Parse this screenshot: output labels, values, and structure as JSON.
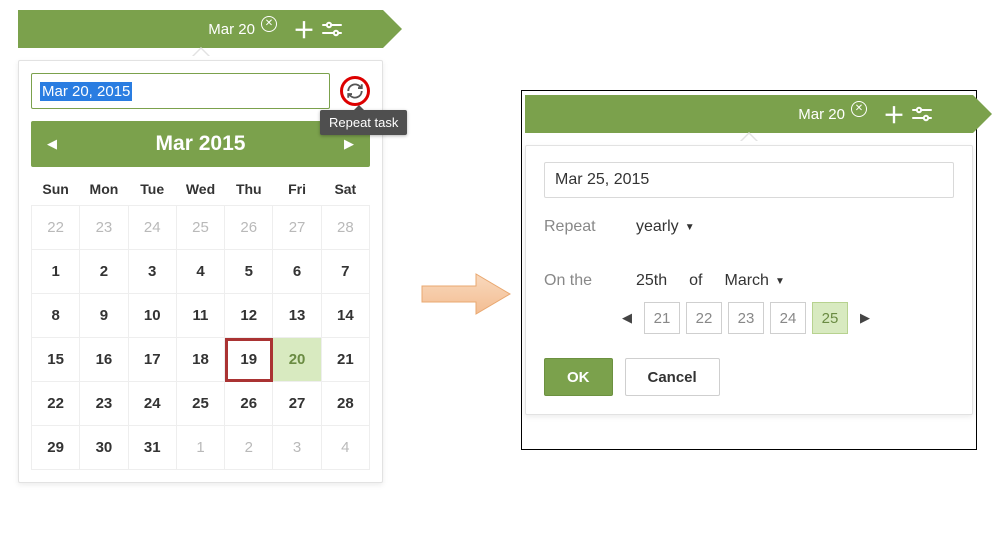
{
  "banner": {
    "date_label": "Mar 20"
  },
  "left": {
    "selected_date_text": "Mar 20, 2015",
    "tooltip": "Repeat task",
    "month_title": "Mar 2015",
    "weekdays": [
      "Sun",
      "Mon",
      "Tue",
      "Wed",
      "Thu",
      "Fri",
      "Sat"
    ],
    "grid": [
      [
        {
          "n": "22",
          "muted": true
        },
        {
          "n": "23",
          "muted": true
        },
        {
          "n": "24",
          "muted": true
        },
        {
          "n": "25",
          "muted": true
        },
        {
          "n": "26",
          "muted": true
        },
        {
          "n": "27",
          "muted": true
        },
        {
          "n": "28",
          "muted": true
        }
      ],
      [
        {
          "n": "1"
        },
        {
          "n": "2"
        },
        {
          "n": "3"
        },
        {
          "n": "4"
        },
        {
          "n": "5"
        },
        {
          "n": "6"
        },
        {
          "n": "7"
        }
      ],
      [
        {
          "n": "8"
        },
        {
          "n": "9"
        },
        {
          "n": "10"
        },
        {
          "n": "11"
        },
        {
          "n": "12"
        },
        {
          "n": "13"
        },
        {
          "n": "14"
        }
      ],
      [
        {
          "n": "15"
        },
        {
          "n": "16"
        },
        {
          "n": "17"
        },
        {
          "n": "18"
        },
        {
          "n": "19",
          "today": true
        },
        {
          "n": "20",
          "sel": true
        },
        {
          "n": "21"
        }
      ],
      [
        {
          "n": "22"
        },
        {
          "n": "23"
        },
        {
          "n": "24"
        },
        {
          "n": "25"
        },
        {
          "n": "26"
        },
        {
          "n": "27"
        },
        {
          "n": "28"
        }
      ],
      [
        {
          "n": "29"
        },
        {
          "n": "30"
        },
        {
          "n": "31"
        },
        {
          "n": "1",
          "muted": true
        },
        {
          "n": "2",
          "muted": true
        },
        {
          "n": "3",
          "muted": true
        },
        {
          "n": "4",
          "muted": true
        }
      ]
    ]
  },
  "right": {
    "date_value": "Mar 25, 2015",
    "repeat_label": "Repeat",
    "repeat_value": "yearly",
    "onthe_label": "On the",
    "day_ordinal": "25th",
    "of_label": "of",
    "month_value": "March",
    "day_options": [
      "21",
      "22",
      "23",
      "24",
      "25"
    ],
    "selected_day": "25",
    "ok_label": "OK",
    "cancel_label": "Cancel"
  }
}
